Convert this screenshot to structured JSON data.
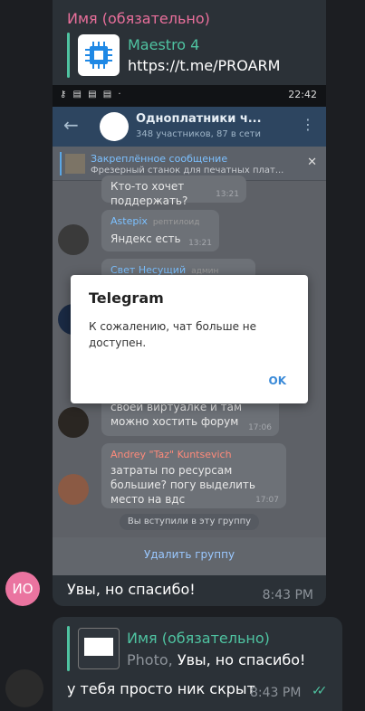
{
  "incoming": {
    "sender": "Имя (обязательно)",
    "link_title": "Maestro 4",
    "link_url": "https://t.me/PROARM",
    "reply_text": "Увы, но спасибо!",
    "reply_time": "8:43 PM",
    "avatar_initials": "ИО"
  },
  "screenshot": {
    "time": "22:42",
    "chat_title": "Одноплатники ч...",
    "chat_sub": "348 участников, 87 в сети",
    "pinned_title": "Закреплённое сообщение",
    "pinned_text": "Фрезерный станок для печатных плат...",
    "msg1_text": "Кто-то хочет поддержать?",
    "msg1_time": "13:21",
    "msg2_name": "Astepix",
    "msg2_badge": "рептилоид",
    "msg2_text": "Яндекс есть",
    "msg2_time": "13:21",
    "msg3_name": "Свет Несущий",
    "msg3_badge": "админ",
    "msg4_text": "своей виртуалке и там можно хостить форум",
    "msg4_time": "17:06",
    "msg5_name": "Andrey \"Taz\" Kuntsevich",
    "msg5_text": "затраты по ресурсам большие? погу выделить место на вдс",
    "msg5_time": "17:07",
    "joined": "Вы вступили в эту группу",
    "delete_btn": "Удалить группу",
    "dialog_title": "Telegram",
    "dialog_text": "К сожалению, чат больше не доступен.",
    "dialog_ok": "OK"
  },
  "outgoing": {
    "quote_name": "Имя (обязательно)",
    "quote_type": "Photo, ",
    "quote_text": "Увы, но спасибо!",
    "text": "у тебя просто ник скрыт",
    "time": "8:43 PM"
  }
}
